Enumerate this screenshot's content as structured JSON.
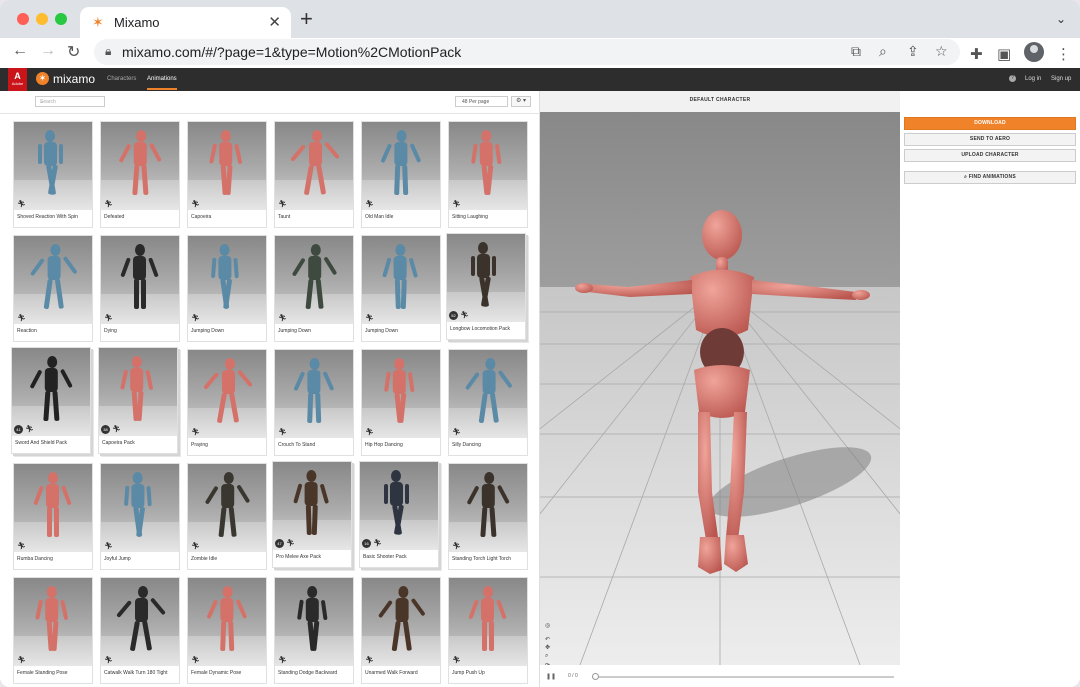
{
  "browser": {
    "tab_title": "Mixamo",
    "tab_close": "✕",
    "new_tab": "+",
    "url": "mixamo.com/#/?page=1&type=Motion%2CMotionPack",
    "icons": [
      "back-icon",
      "forward-icon",
      "reload-icon",
      "lock-icon",
      "translate-icon",
      "zoom-icon",
      "share-icon",
      "bookmark-star-icon",
      "extensions-icon",
      "side-panel-icon",
      "profile-icon",
      "more-menu-icon"
    ]
  },
  "header": {
    "adobe": "A",
    "adobe_sub": "Adobe",
    "logo": "mixamo",
    "nav": [
      "Characters",
      "Animations"
    ],
    "help": "?",
    "login": "Log in",
    "signup": "Sign up",
    "accent_color": "#f0832a"
  },
  "toolbar": {
    "search_placeholder": "Search",
    "per_page": "48 Per page",
    "settings": "⚙ ▾"
  },
  "cards": [
    {
      "label": "Shoved Reaction With Spin",
      "pack": false,
      "badge": "",
      "color": "#5a8aa6"
    },
    {
      "label": "Defeated",
      "pack": false,
      "badge": "",
      "color": "#d4726a"
    },
    {
      "label": "Capoeira",
      "pack": false,
      "badge": "",
      "color": "#d4726a"
    },
    {
      "label": "Taunt",
      "pack": false,
      "badge": "",
      "color": "#d4726a"
    },
    {
      "label": "Old Man Idle",
      "pack": false,
      "badge": "",
      "color": "#5a8aa6"
    },
    {
      "label": "Sitting Laughing",
      "pack": false,
      "badge": "",
      "color": "#d4726a"
    },
    {
      "label": "Reaction",
      "pack": false,
      "badge": "",
      "color": "#5a8aa6"
    },
    {
      "label": "Dying",
      "pack": false,
      "badge": "",
      "color": "#2a2a2a"
    },
    {
      "label": "Jumping Down",
      "pack": false,
      "badge": "",
      "color": "#5a8aa6"
    },
    {
      "label": "Jumping Down",
      "pack": false,
      "badge": "",
      "color": "#3e4a40"
    },
    {
      "label": "Jumping Down",
      "pack": false,
      "badge": "",
      "color": "#5a8aa6"
    },
    {
      "label": "Longbow Locomotion Pack",
      "pack": true,
      "badge": "52",
      "color": "#3b332b"
    },
    {
      "label": "Sword And Shield Pack",
      "pack": true,
      "badge": "41",
      "color": "#222222"
    },
    {
      "label": "Capoeira Pack",
      "pack": true,
      "badge": "38",
      "color": "#d4726a"
    },
    {
      "label": "Praying",
      "pack": false,
      "badge": "",
      "color": "#d4726a"
    },
    {
      "label": "Crouch To Stand",
      "pack": false,
      "badge": "",
      "color": "#5a8aa6"
    },
    {
      "label": "Hip Hop Dancing",
      "pack": false,
      "badge": "",
      "color": "#d4726a"
    },
    {
      "label": "Silly Dancing",
      "pack": false,
      "badge": "",
      "color": "#5a8aa6"
    },
    {
      "label": "Rumba Dancing",
      "pack": false,
      "badge": "",
      "color": "#d4726a"
    },
    {
      "label": "Joyful Jump",
      "pack": false,
      "badge": "",
      "color": "#5a8aa6"
    },
    {
      "label": "Zombie Idle",
      "pack": false,
      "badge": "",
      "color": "#3a3630"
    },
    {
      "label": "Pro Melee Axe Pack",
      "pack": true,
      "badge": "47",
      "color": "#4a3628"
    },
    {
      "label": "Basic Shooter Pack",
      "pack": true,
      "badge": "16",
      "color": "#2e3540"
    },
    {
      "label": "Standing Torch Light Torch",
      "pack": false,
      "badge": "",
      "color": "#3b332b"
    },
    {
      "label": "Female Standing Pose",
      "pack": false,
      "badge": "",
      "color": "#d4726a"
    },
    {
      "label": "Catwalk Walk Turn 180 Tight",
      "pack": false,
      "badge": "",
      "color": "#2a2a2a"
    },
    {
      "label": "Female Dynamic Pose",
      "pack": false,
      "badge": "",
      "color": "#d4726a"
    },
    {
      "label": "Standing Dodge Backward",
      "pack": false,
      "badge": "",
      "color": "#2a2a2a"
    },
    {
      "label": "Unarmed Walk Forward",
      "pack": false,
      "badge": "",
      "color": "#4a3628"
    },
    {
      "label": "Jump Push Up",
      "pack": false,
      "badge": "",
      "color": "#d4726a"
    }
  ],
  "viewport": {
    "title": "DEFAULT CHARACTER",
    "frame": "0 / 0",
    "character_color": "#d4726a"
  },
  "actions": {
    "download": "DOWNLOAD",
    "send_to_aero": "SEND TO AERO",
    "upload_character": "UPLOAD CHARACTER",
    "find_animations": "FIND ANIMATIONS"
  }
}
